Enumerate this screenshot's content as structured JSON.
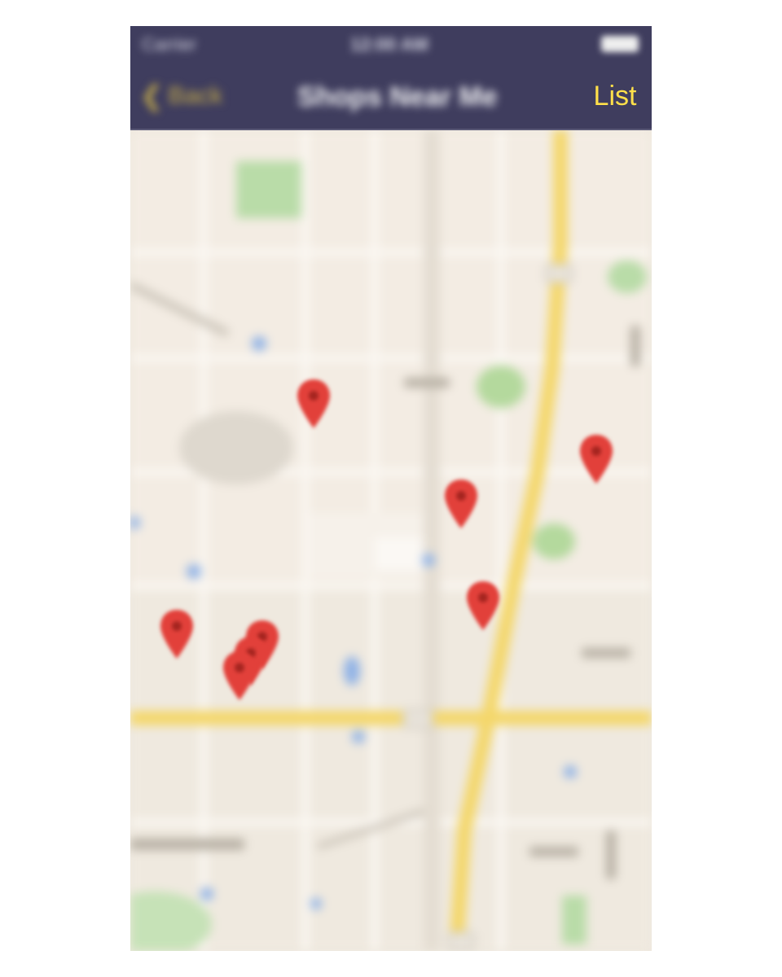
{
  "status_bar": {
    "carrier": "Carrier",
    "time": "12:00 AM"
  },
  "nav": {
    "back_label": "Back",
    "title": "Shops Near Me",
    "list_label": "List"
  },
  "map": {
    "pin_color": "#e2403a",
    "pin_count": 8
  },
  "colors": {
    "nav_background": "#3f3d5e",
    "accent": "#ffe04a",
    "map_background": "#efe9df",
    "highway": "#f4d76b",
    "park": "#b9dca8"
  }
}
